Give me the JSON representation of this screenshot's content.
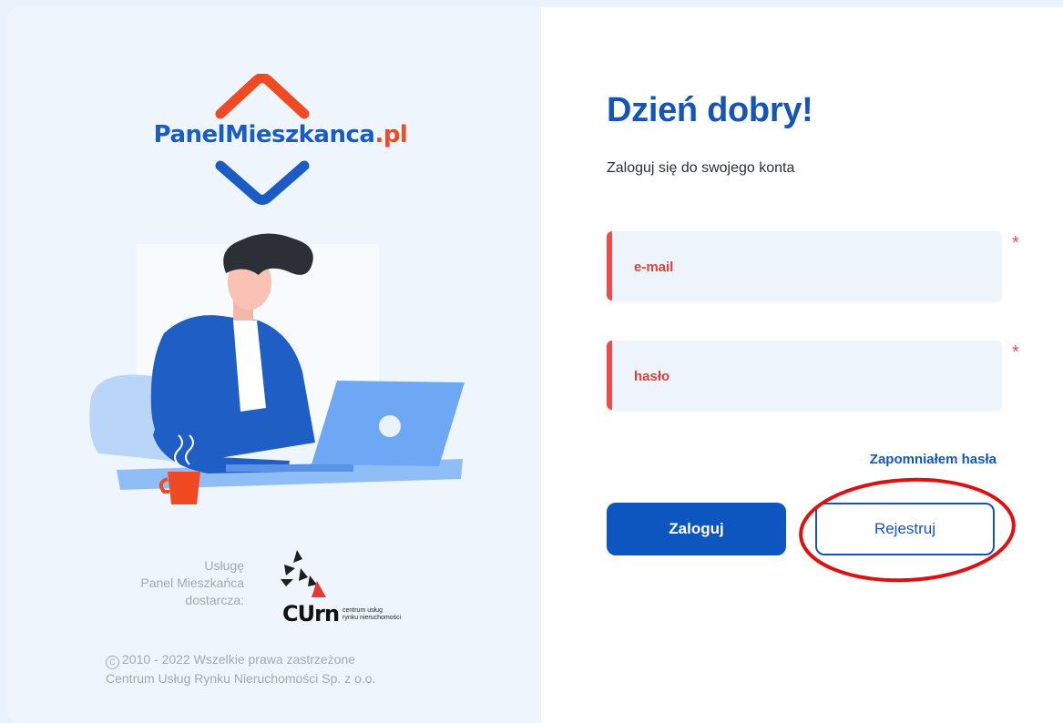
{
  "brand": {
    "logo_text_main": "PanelMieszkanca",
    "logo_text_tld": ".pl"
  },
  "login": {
    "heading": "Dzień dobry!",
    "subheading": "Zaloguj się do swojego konta",
    "email_placeholder": "e-mail",
    "password_placeholder": "hasło",
    "required_mark": "*",
    "forgot_link": "Zapomniałem hasła",
    "login_button": "Zaloguj",
    "register_button": "Rejestruj"
  },
  "provider": {
    "line1": "Usługę",
    "line2": "Panel Mieszkańca",
    "line3": "dostarcza:",
    "logo_big": "CUrn",
    "logo_small_1": "centrum usług",
    "logo_small_2": "rynku nieruchomości"
  },
  "footer": {
    "copyright_symbol": "C",
    "copyright_line1": "2010 - 2022 Wszelkie prawa zastrzeżone",
    "copyright_line2": "Centrum Usług Rynku Nieruchomości Sp. z o.o."
  },
  "colors": {
    "primary": "#0d56c0",
    "accent_orange": "#f04a23",
    "error_red": "#ef4b48",
    "annotation_red": "#e01010"
  },
  "icons": {
    "logo_top": "orange-roof-chevron",
    "logo_bottom": "blue-chevron-down",
    "copyright": "copyright-icon"
  }
}
